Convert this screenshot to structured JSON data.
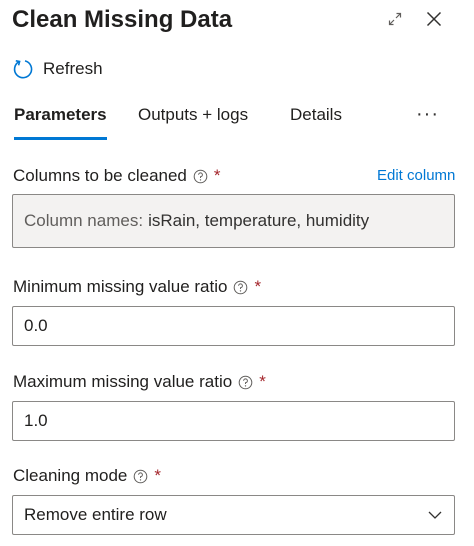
{
  "header": {
    "title": "Clean Missing Data",
    "expand_icon": "expand-icon",
    "close_icon": "close-icon"
  },
  "toolbar": {
    "refresh_label": "Refresh",
    "refresh_icon": "refresh-icon"
  },
  "tabs": [
    {
      "label": "Parameters",
      "active": true
    },
    {
      "label": "Outputs + logs",
      "active": false
    },
    {
      "label": "Details",
      "active": false
    }
  ],
  "more_label": "···",
  "fields": {
    "columns": {
      "label": "Columns to be cleaned",
      "required_mark": "*",
      "edit_link": "Edit column",
      "value_prefix": "Column names:",
      "value": "isRain, temperature, humidity"
    },
    "min_ratio": {
      "label": "Minimum missing value ratio",
      "required_mark": "*",
      "value": "0.0"
    },
    "max_ratio": {
      "label": "Maximum missing value ratio",
      "required_mark": "*",
      "value": "1.0"
    },
    "cleaning_mode": {
      "label": "Cleaning mode",
      "required_mark": "*",
      "value": "Remove entire row"
    }
  },
  "colors": {
    "accent": "#0078d4",
    "required": "#a4262c",
    "readonly_bg": "#f3f2f1",
    "border": "#8a8886"
  }
}
